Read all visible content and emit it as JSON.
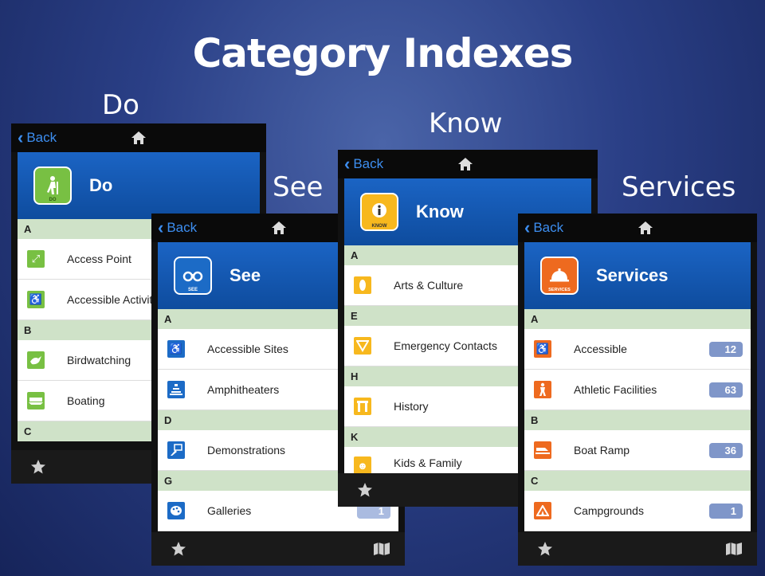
{
  "slide": {
    "title": "Category Indexes",
    "captions": {
      "do": "Do",
      "see": "See",
      "know": "Know",
      "services": "Services"
    }
  },
  "colors": {
    "nav_back": "#3d8ef0",
    "header_blue": "#1b64c4",
    "section_bg": "#cfe2c8",
    "count_badge": "#7f96c9"
  },
  "screens": {
    "do": {
      "back_label": "Back",
      "header_title": "Do",
      "badge_text": "DO",
      "badge_icon": "hiker-icon",
      "sections": {
        "a": "A",
        "b": "B",
        "c": "C"
      },
      "items": {
        "access_point": "Access Point",
        "accessible_activities": "Accessible Activities",
        "birdwatching": "Birdwatching",
        "boating": "Boating"
      }
    },
    "see": {
      "back_label": "Back",
      "header_title": "See",
      "badge_text": "SEE",
      "badge_icon": "binoculars-icon",
      "sections": {
        "a": "A",
        "d": "D",
        "g": "G"
      },
      "items": {
        "accessible_sites": "Accessible Sites",
        "amphitheaters": "Amphitheaters",
        "demonstrations": "Demonstrations",
        "galleries": "Galleries"
      },
      "galleries_count": "1"
    },
    "know": {
      "back_label": "Back",
      "header_title": "Know",
      "badge_text": "KNOW",
      "badge_icon": "info-icon",
      "sections": {
        "a": "A",
        "e": "E",
        "h": "H",
        "k": "K"
      },
      "items": {
        "arts_culture": "Arts & Culture",
        "emergency_contacts": "Emergency Contacts",
        "history": "History",
        "kids_family": "Kids & Family"
      }
    },
    "services": {
      "back_label": "Back",
      "header_title": "Services",
      "badge_text": "SERVICES",
      "badge_icon": "service-bell-icon",
      "sections": {
        "a": "A",
        "b": "B",
        "c": "C"
      },
      "items": {
        "accessible": "Accessible",
        "athletic_facilities": "Athletic Facilities",
        "boat_ramp": "Boat Ramp",
        "campgrounds": "Campgrounds"
      },
      "counts": {
        "accessible": "12",
        "athletic_facilities": "63",
        "boat_ramp": "36",
        "campgrounds": "1"
      }
    }
  }
}
